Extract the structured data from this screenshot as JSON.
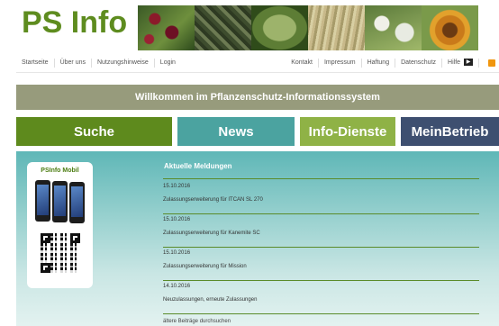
{
  "header": {
    "logo": "PS Info"
  },
  "topnav": {
    "left": [
      "Startseite",
      "Über uns",
      "Nutzungshinweise",
      "Login"
    ],
    "right": [
      "Kontakt",
      "Impressum",
      "Haftung",
      "Datenschutz",
      "Hilfe"
    ]
  },
  "welcome": "Willkommen im Pflanzenschutz-Informationssystem",
  "tabs": [
    "Suche",
    "News",
    "Info-Dienste",
    "MeinBetrieb"
  ],
  "mobile": {
    "title": "PSInfo Mobil"
  },
  "news": {
    "heading": "Aktuelle Meldungen",
    "items": [
      {
        "date": "15.10.2016",
        "title": "Zulassungserweiterung für ITCAN SL 270"
      },
      {
        "date": "15.10.2016",
        "title": "Zulassungserweiterung für Kanemite SC"
      },
      {
        "date": "15.10.2016",
        "title": "Zulassungserweiterung für Mission"
      },
      {
        "date": "14.10.2016",
        "title": "Neuzulassungen, erneute Zulassungen"
      }
    ],
    "more": "ältere Beiträge durchsuchen"
  },
  "colors": {
    "logo": "#5e8c1f",
    "suche": "#5e8a1d",
    "news": "#4ba3a0",
    "info": "#8fb246",
    "mein": "#3e4f70",
    "welcome_bar": "#979b7c"
  }
}
